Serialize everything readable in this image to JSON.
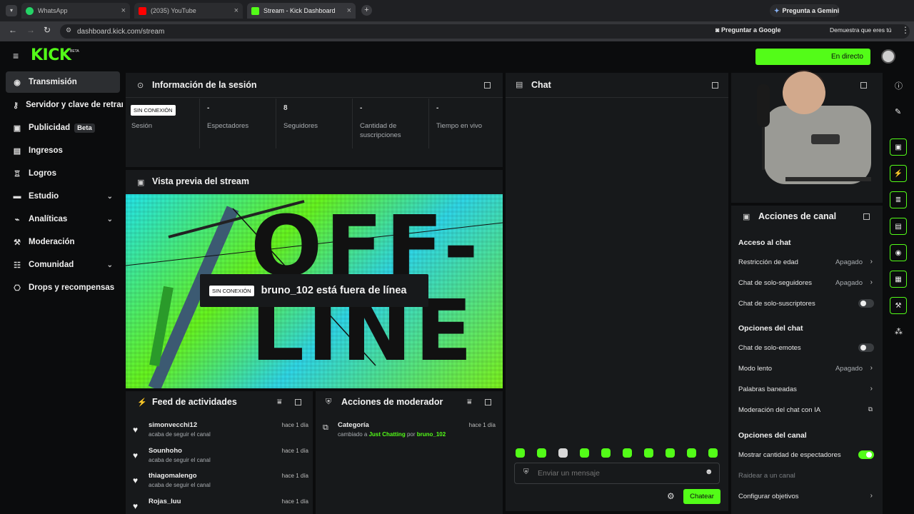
{
  "browser": {
    "tabs": [
      {
        "title": "WhatsApp"
      },
      {
        "title": "(2035) YouTube"
      },
      {
        "title": "Stream - Kick Dashboard"
      }
    ],
    "gemini_label": "Pregunta a Gemini",
    "url": "dashboard.kick.com/stream",
    "ask_google": "Preguntar a Google",
    "verify": "Demuestra que eres tú"
  },
  "brand": {
    "logo": "KICK",
    "beta_mark": "BETA",
    "live_button": "En directo"
  },
  "sidebar": {
    "items": [
      {
        "label": "Transmisión",
        "icon": "broadcast-icon",
        "active": true
      },
      {
        "label": "Servidor y clave de retransmisión",
        "icon": "key-icon"
      },
      {
        "label": "Publicidad",
        "icon": "ads-icon",
        "badge": "Beta"
      },
      {
        "label": "Ingresos",
        "icon": "income-icon"
      },
      {
        "label": "Logros",
        "icon": "trophy-icon"
      },
      {
        "label": "Estudio",
        "icon": "studio-icon",
        "expandable": true
      },
      {
        "label": "Analíticas",
        "icon": "analytics-icon",
        "expandable": true
      },
      {
        "label": "Moderación",
        "icon": "hammer-icon"
      },
      {
        "label": "Comunidad",
        "icon": "community-icon",
        "expandable": true
      },
      {
        "label": "Drops y recompensas",
        "icon": "gift-icon"
      }
    ]
  },
  "session": {
    "title": "Información de la sesión",
    "status_badge": "SIN CONEXIÓN",
    "stats": [
      {
        "value": "",
        "label": "Sesión"
      },
      {
        "value": "-",
        "label": "Espectadores"
      },
      {
        "value": "8",
        "label": "Seguidores"
      },
      {
        "value": "-",
        "label": "Cantidad de suscripciones"
      },
      {
        "value": "-",
        "label": "Tiempo en vivo"
      }
    ]
  },
  "preview": {
    "title": "Vista previa del stream",
    "badge": "SIN CONEXIÓN",
    "message": "bruno_102 está fuera de línea",
    "offline_art": "OFF-LINE"
  },
  "feed": {
    "title": "Feed de actividades",
    "items": [
      {
        "user": "simonvecchi12",
        "action": "acaba de seguir el canal",
        "time": "hace 1 día"
      },
      {
        "user": "Sounhoho",
        "action": "acaba de seguir el canal",
        "time": "hace 1 día"
      },
      {
        "user": "thiagomalengo",
        "action": "acaba de seguir el canal",
        "time": "hace 1 día"
      },
      {
        "user": "Rojas_luu",
        "action": "",
        "time": "hace 1 día"
      }
    ]
  },
  "mod_actions": {
    "title": "Acciones de moderador",
    "items": [
      {
        "title": "Categoría",
        "pre": "cambiado a",
        "category": "Just Chatting",
        "by": "por",
        "user": "bruno_102",
        "time": "hace 1 día"
      }
    ]
  },
  "chat": {
    "title": "Chat",
    "placeholder": "Enviar un mensaje",
    "send_label": "Chatear"
  },
  "channel_actions": {
    "title": "Acciones de canal",
    "sections": [
      {
        "heading": "Acceso al chat",
        "rows": [
          {
            "label": "Restricción de edad",
            "status": "Apagado",
            "kind": "chevron"
          },
          {
            "label": "Chat de solo-seguidores",
            "status": "Apagado",
            "kind": "chevron"
          },
          {
            "label": "Chat de solo-suscriptores",
            "status": "",
            "kind": "toggle-off"
          }
        ]
      },
      {
        "heading": "Opciones del chat",
        "rows": [
          {
            "label": "Chat de solo-emotes",
            "status": "",
            "kind": "toggle-off"
          },
          {
            "label": "Modo lento",
            "status": "Apagado",
            "kind": "chevron"
          },
          {
            "label": "Palabras baneadas",
            "status": "",
            "kind": "chevron"
          },
          {
            "label": "Moderación del chat con IA",
            "status": "",
            "kind": "external"
          }
        ]
      },
      {
        "heading": "Opciones del canal",
        "rows": [
          {
            "label": "Mostrar cantidad de espectadores",
            "status": "",
            "kind": "toggle-on"
          },
          {
            "label": "Raidear a un canal",
            "status": "",
            "kind": "disabled"
          },
          {
            "label": "Configurar objetivos",
            "status": "",
            "kind": "chevron"
          }
        ]
      }
    ]
  },
  "colors": {
    "accent": "#53fc18",
    "panel": "#17191b",
    "bg": "#0b0c0d"
  }
}
